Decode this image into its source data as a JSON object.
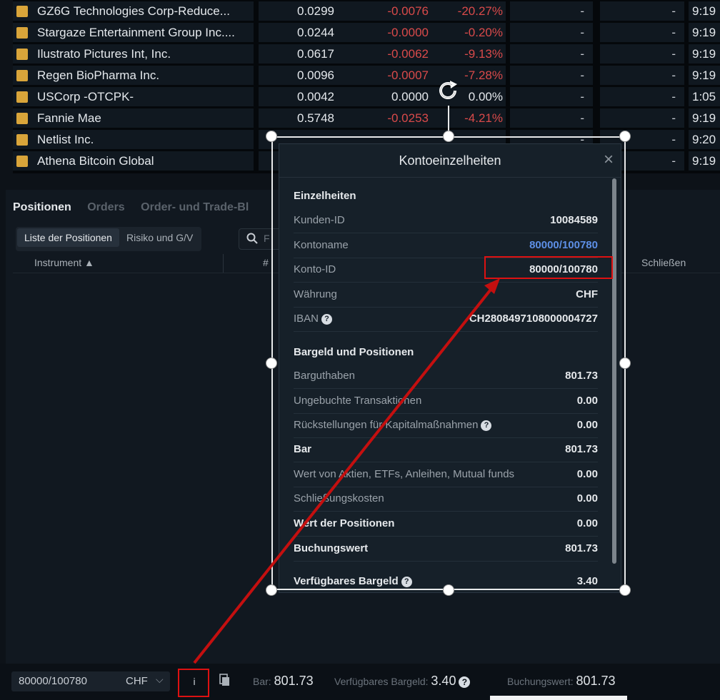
{
  "watchlist": {
    "rows": [
      {
        "name": "GZ6G Technologies Corp-Reduce...",
        "price": "0.0299",
        "change": "-0.0076",
        "pct": "-20.27%",
        "bid": "-",
        "ask": "-",
        "time": "9:19",
        "change_class": "neg",
        "pct_class": "neg"
      },
      {
        "name": "Stargaze Entertainment Group Inc....",
        "price": "0.0244",
        "change": "-0.0000",
        "pct": "-0.20%",
        "bid": "-",
        "ask": "-",
        "time": "9:19",
        "change_class": "neg",
        "pct_class": "neg"
      },
      {
        "name": "Ilustrato Pictures Int, Inc.",
        "price": "0.0617",
        "change": "-0.0062",
        "pct": "-9.13%",
        "bid": "-",
        "ask": "-",
        "time": "9:19",
        "change_class": "neg",
        "pct_class": "neg"
      },
      {
        "name": "Regen BioPharma Inc.",
        "price": "0.0096",
        "change": "-0.0007",
        "pct": "-7.28%",
        "bid": "-",
        "ask": "-",
        "time": "9:19",
        "change_class": "neg",
        "pct_class": "neg"
      },
      {
        "name": "USCorp -OTCPK-",
        "price": "0.0042",
        "change": "0.0000",
        "pct": "0.00%",
        "bid": "-",
        "ask": "-",
        "time": "1:05",
        "change_class": "neu",
        "pct_class": "neu"
      },
      {
        "name": "Fannie Mae",
        "price": "0.5748",
        "change": "-0.0253",
        "pct": "-4.21%",
        "bid": "-",
        "ask": "-",
        "time": "9:19",
        "change_class": "neg",
        "pct_class": "neg"
      },
      {
        "name": "Netlist Inc.",
        "price": "",
        "change": "",
        "pct": "",
        "bid": "-",
        "ask": "-",
        "time": "9:20",
        "change_class": "neg",
        "pct_class": "neg"
      },
      {
        "name": "Athena Bitcoin Global",
        "price": "",
        "change": "",
        "pct": "",
        "bid": "-",
        "ask": "-",
        "time": "9:19",
        "change_class": "neg",
        "pct_class": "neg"
      }
    ]
  },
  "positions": {
    "tabs": [
      "Positionen",
      "Orders",
      "Order- und Trade-Bl"
    ],
    "subtabs": [
      "Liste der Positionen",
      "Risiko und G/V"
    ],
    "search_placeholder": "F",
    "columns": {
      "instrument": "Instrument ▲",
      "hash": "#",
      "close": "Schließen"
    }
  },
  "modal": {
    "title": "Kontoeinzelheiten",
    "section1": "Einzelheiten",
    "rows1": [
      {
        "label": "Kunden-ID",
        "value": "10084589"
      },
      {
        "label": "Kontoname",
        "value": "80000/100780"
      },
      {
        "label": "Konto-ID",
        "value": "80000/100780"
      },
      {
        "label": "Währung",
        "value": "CHF"
      },
      {
        "label": "IBAN",
        "value": "CH2808497108000004727"
      }
    ],
    "section2": "Bargeld und Positionen",
    "rows2": [
      {
        "label": "Barguthaben",
        "value": "801.73"
      },
      {
        "label": "Ungebuchte Transaktionen",
        "value": "0.00"
      },
      {
        "label": "Rückstellungen für Kapitalmaßnahmen",
        "value": "0.00"
      },
      {
        "label": "Bar",
        "value": "801.73"
      },
      {
        "label": "Wert von Aktien, ETFs, Anleihen, Mutual funds",
        "value": "0.00"
      },
      {
        "label": "Schließungskosten",
        "value": "0.00"
      },
      {
        "label": "Wert der Positionen",
        "value": "0.00"
      },
      {
        "label": "Buchungswert",
        "value": "801.73"
      },
      {
        "label": "Verfügbares Bargeld",
        "value": "3.40"
      }
    ]
  },
  "footer": {
    "account": "80000/100780",
    "currency": "CHF",
    "info_label": "i",
    "bar_label": "Bar:",
    "bar_value": "801.73",
    "avail_label": "Verfügbares Bargeld:",
    "avail_value": "3.40",
    "book_label": "Buchungswert:",
    "book_value": "801.73"
  },
  "colors": {
    "accent_link": "#5d8fe6",
    "negative": "#d94a4a",
    "annotation": "#dd1111"
  },
  "icons": [
    "close-icon",
    "search-icon",
    "chevron-down-icon",
    "info-icon",
    "document-icon",
    "help-icon",
    "rotate-icon",
    "stock-logo-icon"
  ]
}
